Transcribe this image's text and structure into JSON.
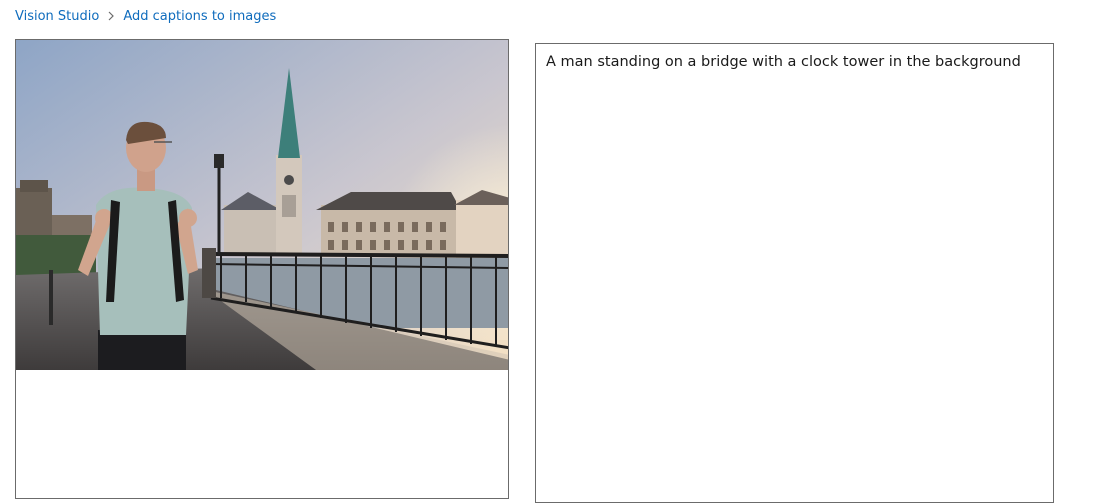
{
  "breadcrumb": {
    "root": "Vision Studio",
    "current": "Add captions to images",
    "separator_icon": "chevron-right-icon"
  },
  "image_panel": {
    "photo_description_icon": "uploaded-photo"
  },
  "caption_panel": {
    "caption": "A man standing on a bridge with a clock tower in the background"
  },
  "colors": {
    "link": "#0f6cbd",
    "border": "#6b6b6b",
    "text": "#1a1a1a"
  }
}
